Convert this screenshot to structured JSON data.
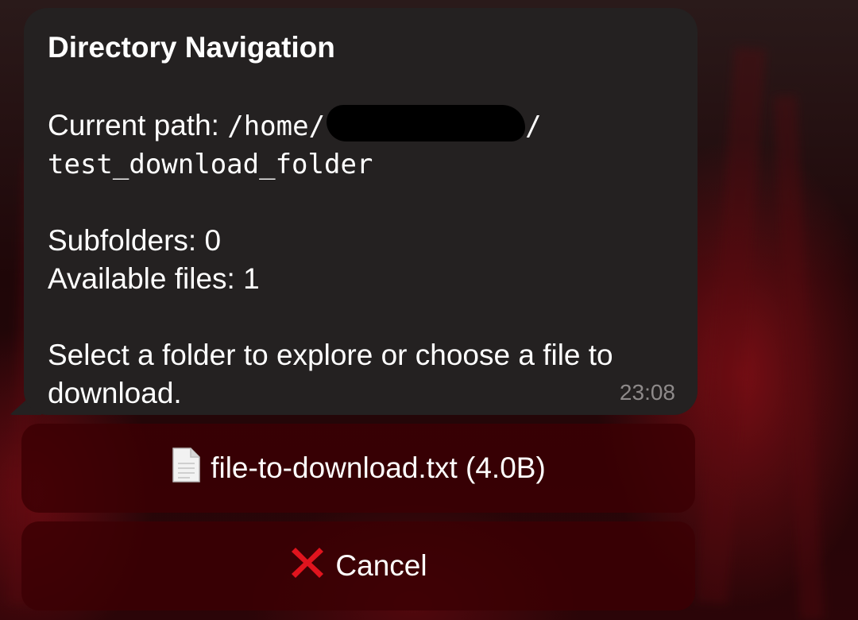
{
  "message": {
    "title": "Directory Navigation",
    "path_label": "Current path:",
    "path_prefix": "/home/",
    "path_suffix": "/",
    "path_folder": "test_download_folder",
    "subfolders": "Subfolders: 0",
    "available_files": "Available files: 1",
    "instruction_line1": "Select a folder to explore or choose a file to",
    "instruction_line2": "download.",
    "time": "23:08"
  },
  "keyboard": {
    "file_button_label": "file-to-download.txt (4.0B)",
    "file_button_icon": "document-icon",
    "cancel_button_label": "Cancel",
    "cancel_button_icon": "red-x-icon"
  },
  "colors": {
    "bubble": "#242121",
    "button": "#3c0004",
    "cancel_icon": "#e0141e",
    "timestamp": "#8e8a8a"
  }
}
